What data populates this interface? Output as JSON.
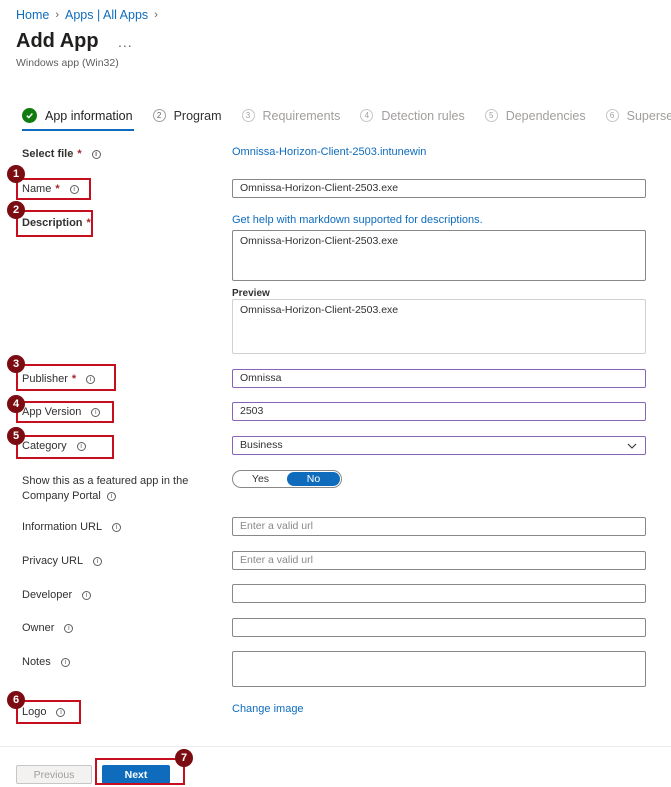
{
  "breadcrumb": {
    "home": "Home",
    "apps": "Apps | All Apps"
  },
  "page": {
    "title": "Add App",
    "more": "...",
    "subtitle": "Windows app (Win32)"
  },
  "tabs": [
    {
      "num": "✓",
      "label": "App information"
    },
    {
      "num": "2",
      "label": "Program"
    },
    {
      "num": "3",
      "label": "Requirements"
    },
    {
      "num": "4",
      "label": "Detection rules"
    },
    {
      "num": "5",
      "label": "Dependencies"
    },
    {
      "num": "6",
      "label": "Supersed"
    }
  ],
  "form": {
    "select_file": {
      "label": "Select file",
      "req": "*",
      "value": "Omnissa-Horizon-Client-2503.intunewin"
    },
    "name": {
      "label": "Name",
      "req": "*",
      "value": "Omnissa-Horizon-Client-2503.exe"
    },
    "description": {
      "label": "Description",
      "req": "*",
      "help_link": "Get help with markdown supported for descriptions.",
      "value": "Omnissa-Horizon-Client-2503.exe"
    },
    "preview": {
      "label": "Preview",
      "value": "Omnissa-Horizon-Client-2503.exe"
    },
    "publisher": {
      "label": "Publisher",
      "req": "*",
      "value": "Omnissa"
    },
    "app_version": {
      "label": "App Version",
      "value": "2503"
    },
    "category": {
      "label": "Category",
      "value": "Business"
    },
    "featured": {
      "label_line1": "Show this as a featured app in the",
      "label_line2": "Company Portal",
      "yes": "Yes",
      "no": "No"
    },
    "info_url": {
      "label": "Information URL",
      "placeholder": "Enter a valid url"
    },
    "privacy_url": {
      "label": "Privacy URL",
      "placeholder": "Enter a valid url"
    },
    "developer": {
      "label": "Developer",
      "value": ""
    },
    "owner": {
      "label": "Owner",
      "value": ""
    },
    "notes": {
      "label": "Notes",
      "value": ""
    },
    "logo": {
      "label": "Logo",
      "link": "Change image"
    }
  },
  "footer": {
    "previous": "Previous",
    "next": "Next"
  },
  "badges": [
    "1",
    "2",
    "3",
    "4",
    "5",
    "6",
    "7"
  ],
  "colors": {
    "accent": "#0f6cbd",
    "success": "#107c10",
    "callout": "#c50f1f",
    "badge": "#7b0c12",
    "required": "#a4262c"
  }
}
